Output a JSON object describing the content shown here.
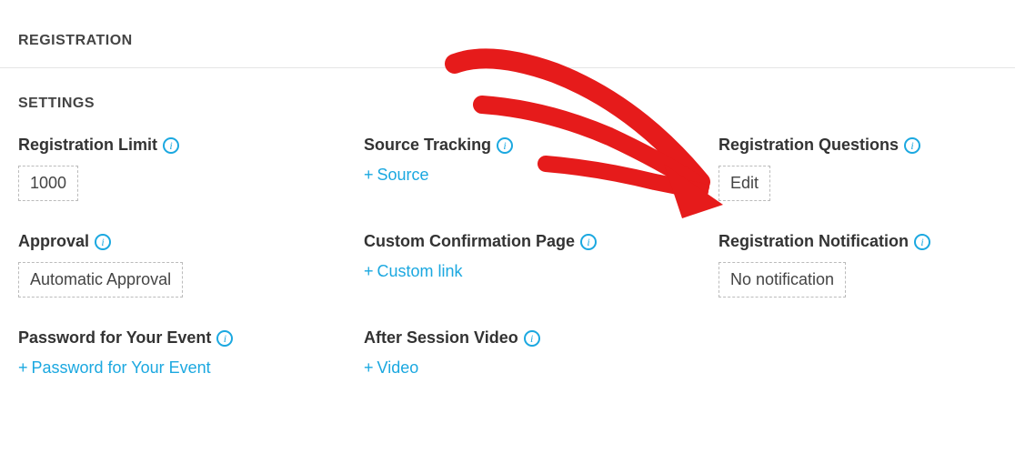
{
  "headers": {
    "registration": "REGISTRATION",
    "settings": "SETTINGS"
  },
  "plus": "+",
  "info_glyph": "i",
  "col1": {
    "limit": {
      "label": "Registration Limit",
      "value": "1000"
    },
    "approval": {
      "label": "Approval",
      "value": "Automatic Approval"
    },
    "password": {
      "label": "Password for Your Event",
      "link": "Password for Your Event"
    }
  },
  "col2": {
    "source": {
      "label": "Source Tracking",
      "link": "Source"
    },
    "confirm": {
      "label": "Custom Confirmation Page",
      "link": "Custom link"
    },
    "video": {
      "label": "After Session Video",
      "link": "Video"
    }
  },
  "col3": {
    "questions": {
      "label": "Registration Questions",
      "value": "Edit"
    },
    "notification": {
      "label": "Registration Notification",
      "value": "No notification"
    }
  }
}
